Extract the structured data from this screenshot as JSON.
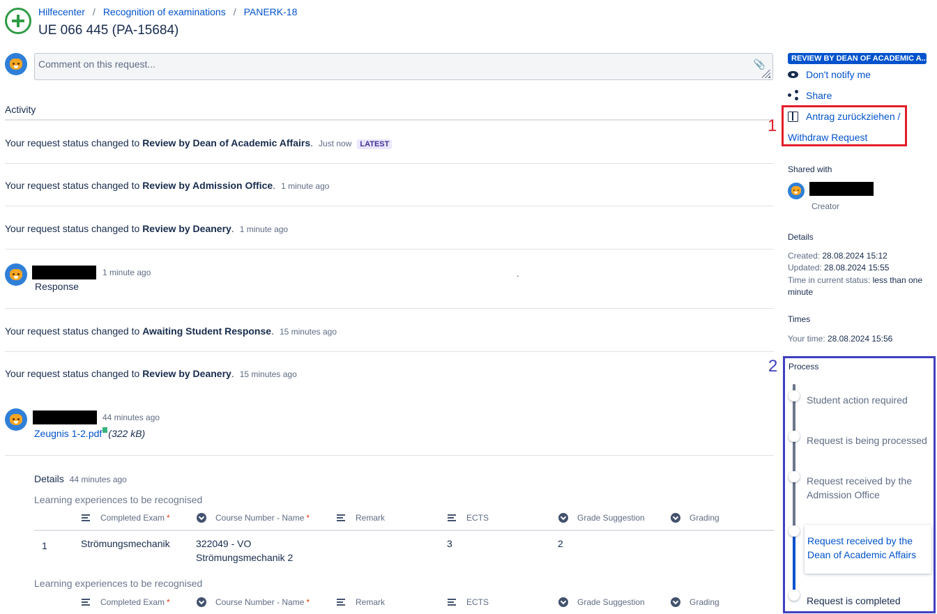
{
  "breadcrumb": [
    "Hilfecenter",
    "Recognition of examinations",
    "PANERK-18"
  ],
  "page_title": "UE 066 445 (PA-15684)",
  "comment": {
    "placeholder": "Comment on this request..."
  },
  "activity": {
    "heading": "Activity",
    "prefix": "Your request status changed to",
    "items": [
      {
        "status": "Review by Dean of Academic Affairs",
        "time": "Just now",
        "badge": "LATEST"
      },
      {
        "status": "Review by Admission Office",
        "time": "1 minute ago"
      },
      {
        "status": "Review by Deanery",
        "time": "1 minute ago"
      }
    ],
    "response": {
      "time": "1 minute ago",
      "text": "Response",
      "dot": "."
    },
    "items2": [
      {
        "status": "Awaiting Student Response",
        "time": "15 minutes ago"
      },
      {
        "status": "Review by Deanery",
        "time": "15 minutes ago"
      }
    ],
    "attachment": {
      "time": "44 minutes ago",
      "file": "Zeugnis 1-2.pdf",
      "size": "(322 kB)"
    }
  },
  "details": {
    "heading": "Details",
    "time": "44 minutes ago",
    "section_label": "Learning experiences to be recognised",
    "columns": [
      "Completed Exam",
      "Course Number - Name",
      "Remark",
      "ECTS",
      "Grade Suggestion",
      "Grading"
    ],
    "row": {
      "index": "1",
      "exam": "Strömungsmechanik",
      "course_line1": "322049 - VO",
      "course_line2": "Strömungsmechanik 2",
      "ects": "3",
      "grade": "2"
    }
  },
  "sidebar": {
    "status": "REVIEW BY DEAN OF ACADEMIC A...",
    "notify": "Don't notify me",
    "share": "Share",
    "withdraw_line1": "Antrag zurückziehen /",
    "withdraw_line2": "Withdraw Request",
    "annotation_1": "1",
    "annotation_2": "2",
    "shared_with": "Shared with",
    "creator": "Creator",
    "details_heading": "Details",
    "created_label": "Created:",
    "created": "28.08.2024 15:12",
    "updated_label": "Updated:",
    "updated": "28.08.2024 15:55",
    "status_time_label": "Time in current status:",
    "status_time": "less than one minute",
    "times_heading": "Times",
    "your_time_label": "Your time:",
    "your_time": "28.08.2024 15:56",
    "process_heading": "Process",
    "steps": [
      "Student action required",
      "Request is being processed",
      "Request received by the Admission Office",
      "Request received by the Dean of Academic Affairs",
      "Request is completed"
    ]
  },
  "colors": {
    "link": "#0052cc",
    "status_lozenge": "#0052cc",
    "annotation_red": "#e21d2a",
    "annotation_blue": "#3f3fbf",
    "logo_green": "#2e9b45"
  }
}
